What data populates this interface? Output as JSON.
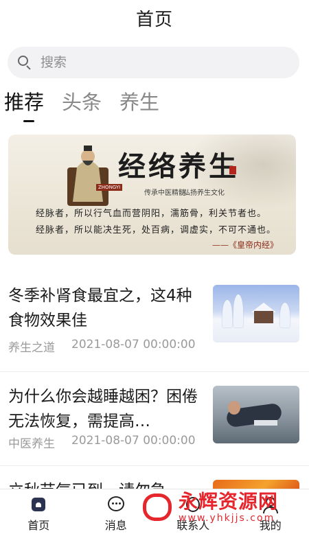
{
  "header": {
    "title": "首页"
  },
  "search": {
    "placeholder": "搜索",
    "icon": "search-icon"
  },
  "tabs": [
    {
      "label": "推荐",
      "active": true
    },
    {
      "label": "头条",
      "active": false
    },
    {
      "label": "养生",
      "active": false
    }
  ],
  "banner": {
    "title": "经络养生",
    "subtitle_left": "传承中医精髓",
    "subtitle_right": "弘扬养生文化",
    "tag": "ZHONGYI",
    "line1": "经脉者，所以行气血而营阴阳，濡筋骨，利关节者也。",
    "line2": "经脉者，所以能决生死，处百病，调虚实，不可不通也。",
    "signature": "——《皇帝内经》"
  },
  "news": [
    {
      "title": "冬季补肾食最宜之，这4种食物效果佳",
      "category": "养生之道",
      "date": "2021-08-07 00:00:00",
      "thumb": "snow-cabin"
    },
    {
      "title": "为什么你会越睡越困？困倦无法恢复，需提高…",
      "category": "中医养生",
      "date": "2021-08-07 00:00:00",
      "thumb": "person-sleeping"
    },
    {
      "title": "立秋节气已到，请勿急",
      "category": "",
      "date": "",
      "thumb": "autumn-leaves"
    }
  ],
  "tabbar": [
    {
      "label": "首页",
      "icon": "home-icon",
      "active": true
    },
    {
      "label": "消息",
      "icon": "message-icon",
      "active": false
    },
    {
      "label": "联系人",
      "icon": "contact-icon",
      "active": false
    },
    {
      "label": "我的",
      "icon": "profile-icon",
      "active": false
    }
  ],
  "watermark": {
    "text": "永辉资源网",
    "url": "www.yhkjjs.com"
  },
  "colors": {
    "accent": "#2b3350",
    "watermark": "#e5262c",
    "muted": "#9a9a9a"
  }
}
